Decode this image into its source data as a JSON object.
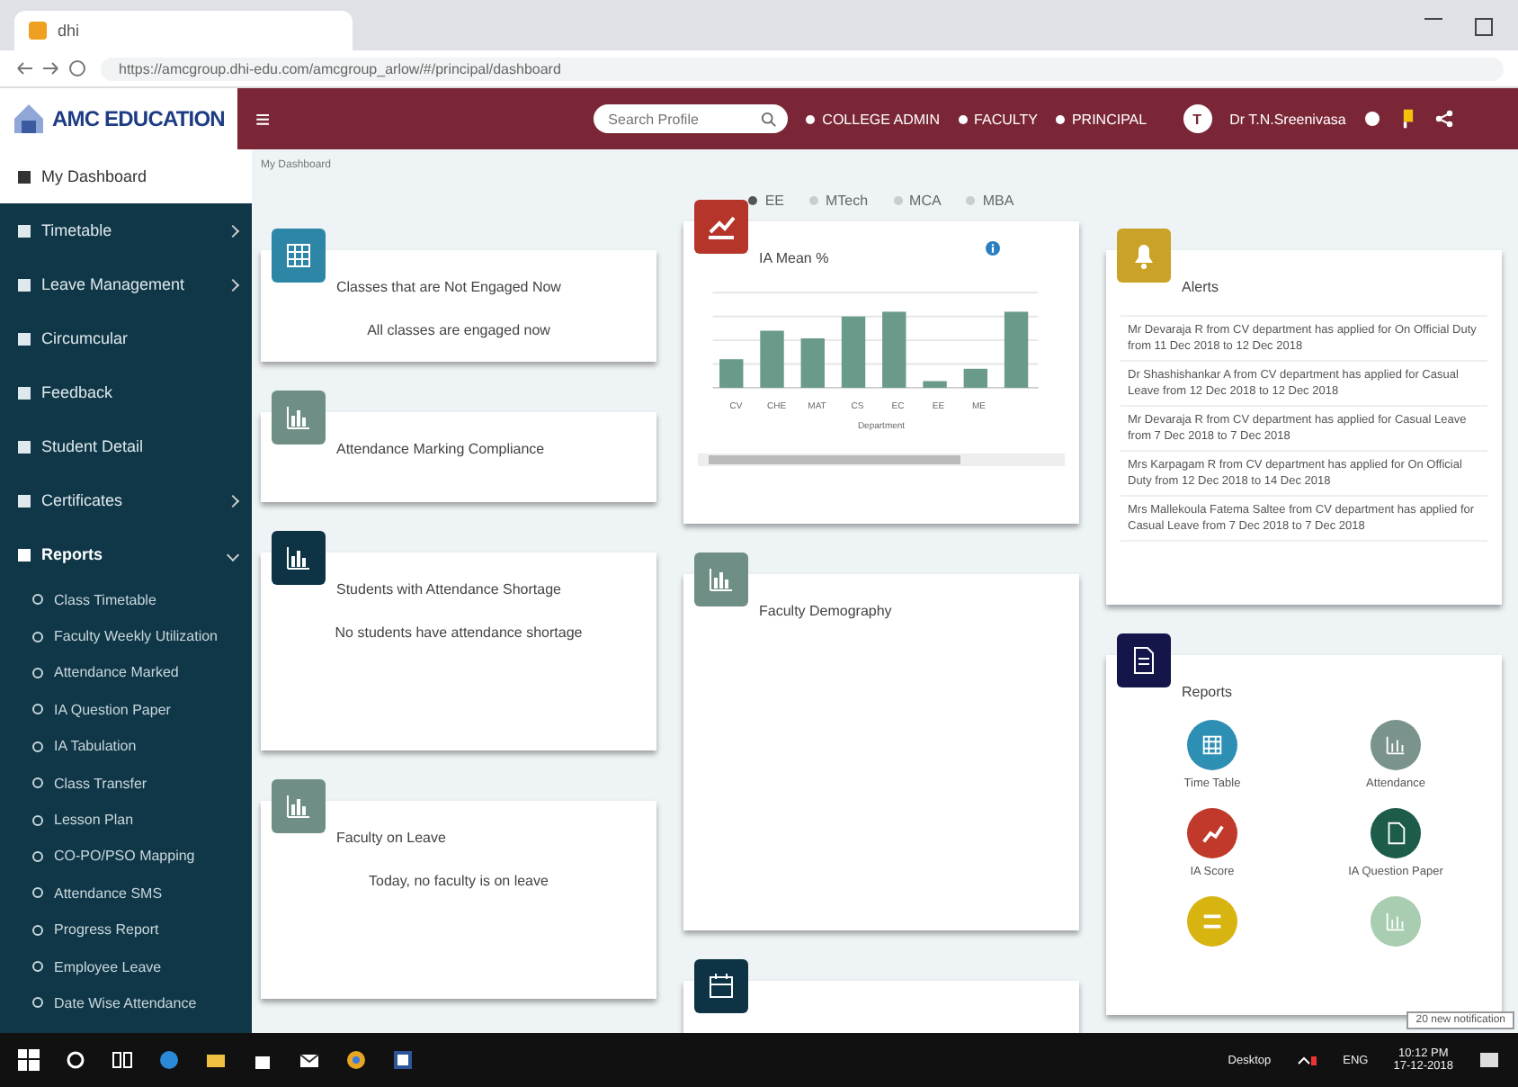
{
  "browser": {
    "tab_title": "dhi",
    "url": "https://amcgroup.dhi-edu.com/amcgroup_arlow/#/principal/dashboard"
  },
  "header": {
    "logo": "AMC EDUCATION",
    "menu_glyph": "≡",
    "search": {
      "placeholder": "Search Profile"
    },
    "roles": [
      {
        "label": "COLLEGE ADMIN"
      },
      {
        "label": "FACULTY"
      },
      {
        "label": "PRINCIPAL"
      }
    ],
    "avatar": "T",
    "user": "Dr T.N.Sreenivasa"
  },
  "sidebar": {
    "items": [
      {
        "label": "My Dashboard",
        "selected": true,
        "expandable": false
      },
      {
        "label": "Timetable",
        "selected": false,
        "expandable": true
      },
      {
        "label": "Leave Management",
        "selected": false,
        "expandable": true
      },
      {
        "label": "Circumcular",
        "selected": false,
        "expandable": false
      },
      {
        "label": "Feedback",
        "selected": false,
        "expandable": false
      },
      {
        "label": "Student Detail",
        "selected": false,
        "expandable": false
      },
      {
        "label": "Certificates",
        "selected": false,
        "expandable": true
      },
      {
        "label": "Reports",
        "selected": false,
        "expandable": true,
        "expanded": true,
        "children": [
          {
            "label": "Class Timetable"
          },
          {
            "label": "Faculty Weekly Utilization"
          },
          {
            "label": "Attendance Marked"
          },
          {
            "label": "IA Question Paper"
          },
          {
            "label": "IA Tabulation"
          },
          {
            "label": "Class Transfer"
          },
          {
            "label": "Lesson Plan"
          },
          {
            "label": "CO-PO/PSO Mapping"
          },
          {
            "label": "Attendance SMS"
          },
          {
            "label": "Progress Report"
          },
          {
            "label": "Employee Leave"
          },
          {
            "label": "Date Wise Attendance"
          }
        ]
      }
    ]
  },
  "breadcrumb": "My Dashboard",
  "legend": [
    {
      "label": "EE",
      "selected": true
    },
    {
      "label": "MTech",
      "selected": false
    },
    {
      "label": "MCA",
      "selected": false
    },
    {
      "label": "MBA",
      "selected": false
    }
  ],
  "columns": [
    [
      {
        "title": "Classes that are Not Engaged Now",
        "message": "All classes are engaged now",
        "kind": "grid",
        "color": "#2e86a6"
      },
      {
        "title": "Attendance Marking Compliance",
        "kind": "bars",
        "color": "#6f8f86"
      },
      {
        "title": "Students with Attendance Shortage",
        "message": "No students have attendance shortage",
        "kind": "bars",
        "color": "#0e3344"
      },
      {
        "title": "Faculty on Leave",
        "message": "Today, no faculty is on leave",
        "kind": "bars",
        "color": "#6f8f86"
      }
    ],
    [
      {
        "title": "IA Mean %",
        "kind": "line",
        "color": "#b5352b",
        "chart_labels": [
          "CV",
          "CHE",
          "MAT",
          "CS",
          "EC",
          "EE",
          "ME"
        ],
        "axis_title": "Department"
      },
      {
        "title": "Faculty Demography",
        "kind": "bars",
        "color": "#6f8f86"
      },
      {
        "kind": "calendar",
        "color": "#0e3344"
      }
    ],
    [
      {
        "title": "Alerts",
        "kind": "bell",
        "color": "#c9a227",
        "alerts": [
          "Mr Devaraja R from CV department has applied for On Official Duty from 11 Dec 2018 to 12 Dec 2018",
          "Dr Shashishankar A from CV department has applied for Casual Leave from 12 Dec 2018 to 12 Dec 2018",
          "Mr Devaraja R from CV department has applied for Casual Leave from 7 Dec 2018 to 7 Dec 2018",
          "Mrs Karpagam R from CV department has applied for On Official Duty from 12 Dec 2018 to 14 Dec 2018",
          "Mrs Mallekoula Fatema Saltee from CV department has applied for Casual Leave from 7 Dec 2018 to 7 Dec 2018"
        ]
      },
      {
        "title": "Reports",
        "kind": "doc",
        "color": "#14164a",
        "reports": [
          {
            "label": "Time Table",
            "kind": "grid",
            "color": "#2e8fb5"
          },
          {
            "label": "Attendance",
            "kind": "bars",
            "color": "#7a938c"
          },
          {
            "label": "IA Score",
            "kind": "line",
            "color": "#c0392b"
          },
          {
            "label": "IA Question Paper",
            "kind": "doc",
            "color": "#1d5b4a"
          },
          {
            "kind": "swap",
            "color": "#d8b411"
          },
          {
            "kind": "bars",
            "color": "#a8cdb0"
          }
        ]
      }
    ]
  ],
  "toast": "20 new notification",
  "taskbar": {
    "desktop": "Desktop",
    "lang": "ENG",
    "time": "10:12 PM",
    "date": "17-12-2018"
  }
}
